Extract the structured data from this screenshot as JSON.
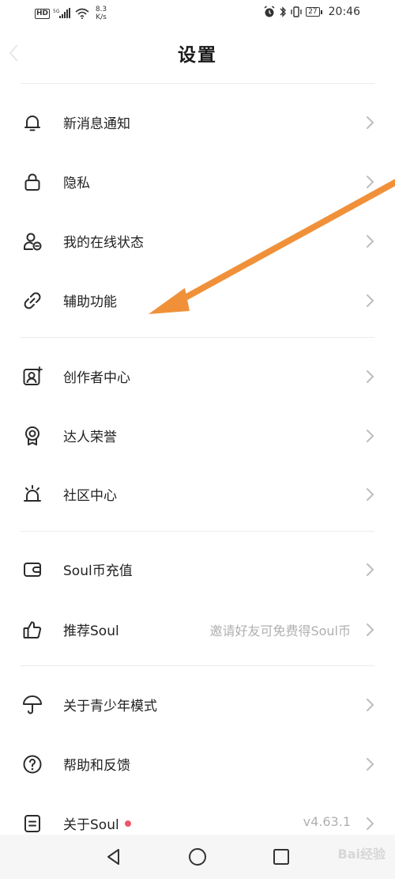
{
  "status_bar": {
    "hd": "HD",
    "net_speed_value": "8.3",
    "net_speed_unit": "K/s",
    "battery": "27",
    "time": "20:46"
  },
  "header": {
    "title": "设置"
  },
  "settings": {
    "notifications": "新消息通知",
    "privacy": "隐私",
    "online_status": "我的在线状态",
    "accessibility": "辅助功能",
    "creator_center": "创作者中心",
    "expert_honor": "达人荣誉",
    "community_center": "社区中心",
    "recharge": "Soul币充值",
    "recommend": "推荐Soul",
    "recommend_hint": "邀请好友可免费得Soul币",
    "youth_mode": "关于青少年模式",
    "help_feedback": "帮助和反馈",
    "about": "关于Soul",
    "about_version": "v4.63.1"
  },
  "icons": {
    "notifications": "bell-icon",
    "privacy": "lock-icon",
    "online_status": "user-status-icon",
    "accessibility": "link-icon",
    "creator_center": "creator-icon",
    "expert_honor": "badge-icon",
    "community_center": "alarm-light-icon",
    "recharge": "wallet-icon",
    "recommend": "thumbs-up-icon",
    "youth_mode": "umbrella-icon",
    "help_feedback": "help-circle-icon",
    "about": "document-icon"
  },
  "watermark": "Bai经验",
  "colors": {
    "arrow": "#f0913a",
    "red_dot": "#f0566a",
    "text": "#222222",
    "hint": "#b0b0b0",
    "divider": "#ececec"
  }
}
